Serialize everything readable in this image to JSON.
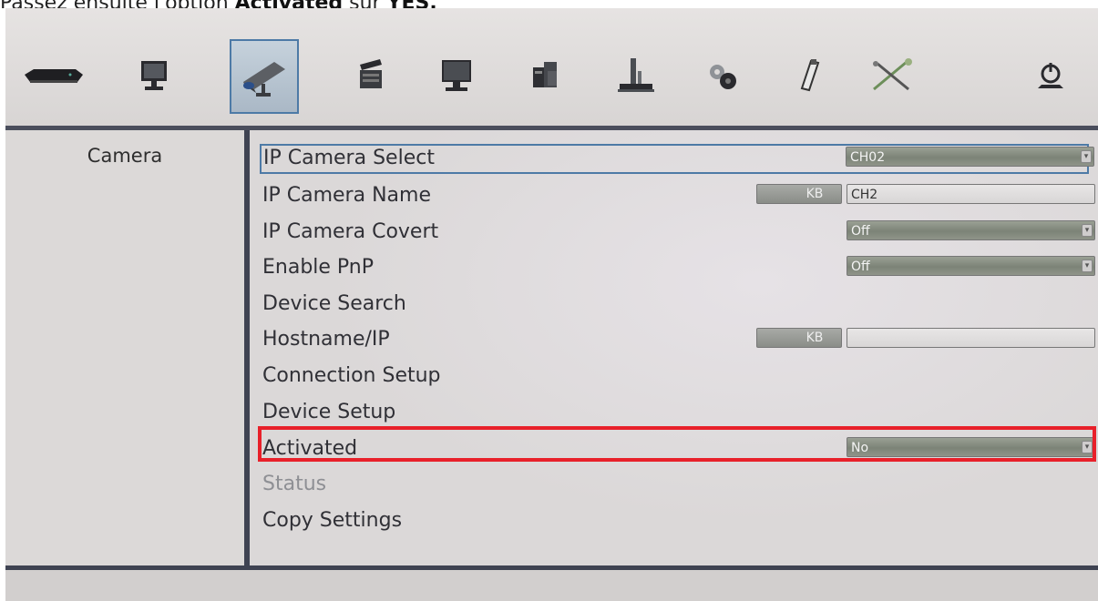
{
  "caption": {
    "lead": "Passez ensuite l'option",
    "bold1": "Activated",
    "mid": "sur",
    "bold2": "YES."
  },
  "toolbar": {
    "items": [
      {
        "icon": "dvr-box-icon"
      },
      {
        "icon": "monitor-icon"
      },
      {
        "icon": "camera-icon",
        "selected": true
      },
      {
        "icon": "clapperboard-icon"
      },
      {
        "icon": "display-icon"
      },
      {
        "icon": "network-devices-icon"
      },
      {
        "icon": "storage-icon"
      },
      {
        "icon": "gears-icon"
      },
      {
        "icon": "usb-stick-icon"
      },
      {
        "icon": "tools-icon"
      },
      {
        "icon": "power-icon"
      }
    ]
  },
  "sidebar": {
    "title": "Camera"
  },
  "menu": {
    "ip_camera_select": {
      "label": "IP Camera Select",
      "value": "CH02"
    },
    "ip_camera_name": {
      "label": "IP Camera Name",
      "kb": "KB",
      "value": "CH2"
    },
    "ip_camera_covert": {
      "label": "IP Camera Covert",
      "value": "Off"
    },
    "enable_pnp": {
      "label": "Enable PnP",
      "value": "Off"
    },
    "device_search": {
      "label": "Device Search"
    },
    "hostname_ip": {
      "label": "Hostname/IP",
      "kb": "KB",
      "value": ""
    },
    "connection_setup": {
      "label": "Connection Setup"
    },
    "device_setup": {
      "label": "Device Setup"
    },
    "activated": {
      "label": "Activated",
      "value": "No"
    },
    "status": {
      "label": "Status"
    },
    "copy_settings": {
      "label": "Copy Settings"
    }
  },
  "colors": {
    "highlight": "#e8202a",
    "selection": "#4d7aa6",
    "divider": "#3f4352"
  }
}
